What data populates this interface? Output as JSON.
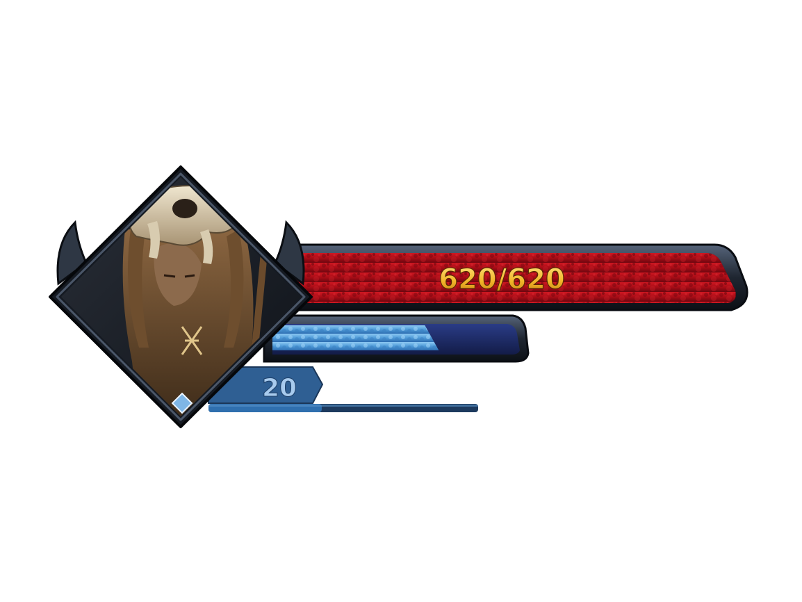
{
  "hud": {
    "health": {
      "current": 620,
      "max": 620,
      "label": "620/620",
      "fill_fraction": 1.0,
      "color": "#b0101a"
    },
    "mana": {
      "fill_fraction": 0.68,
      "color": "#5aa6e0"
    },
    "experience": {
      "fill_fraction": 0.42,
      "color": "#2a6aa8"
    },
    "level": {
      "value": "20"
    },
    "portrait": {
      "icon": "skull-hooded-hero-portrait",
      "frame_color": "#1a2028"
    },
    "colors": {
      "frame_dark": "#151a22",
      "frame_steel": "#3b4656",
      "health_text": "#f2c230",
      "level_text": "#9fc3e6",
      "level_tab": "#2f5f93"
    }
  }
}
